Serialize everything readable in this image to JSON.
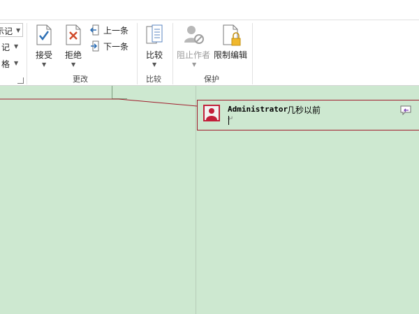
{
  "ribbon": {
    "partial_items": [
      "示记",
      "记",
      "格"
    ],
    "accept_label": "接受",
    "reject_label": "拒绝",
    "previous_label": "上一条",
    "next_label": "下一条",
    "compare_label": "比较",
    "block_authors_label": "阻止作者",
    "restrict_editing_label": "限制编辑",
    "groups": {
      "changes": "更改",
      "compare": "比较",
      "protect": "保护"
    }
  },
  "comment": {
    "author": "Administrator",
    "time": "几秒以前"
  },
  "colors": {
    "document_bg": "#cde8d0",
    "comment_border": "#a01c2c",
    "avatar_bg": "#c21f3a",
    "accept_check": "#2d6fb5",
    "reject_x": "#d04b2b"
  }
}
